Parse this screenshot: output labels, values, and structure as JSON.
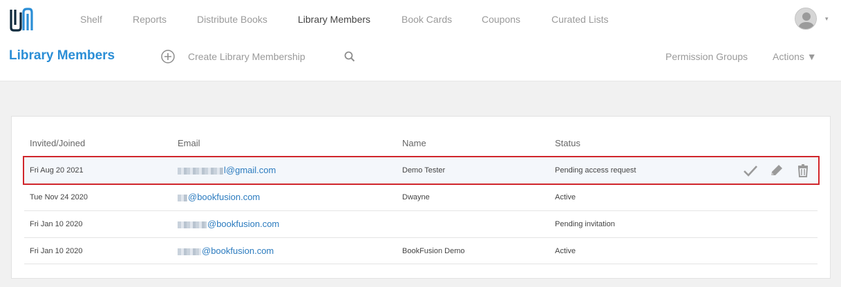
{
  "nav": {
    "items": [
      {
        "label": "Shelf",
        "active": false
      },
      {
        "label": "Reports",
        "active": false
      },
      {
        "label": "Distribute Books",
        "active": false
      },
      {
        "label": "Library Members",
        "active": true
      },
      {
        "label": "Book Cards",
        "active": false
      },
      {
        "label": "Coupons",
        "active": false
      },
      {
        "label": "Curated Lists",
        "active": false
      }
    ],
    "caret": "▾"
  },
  "subheader": {
    "title": "Library Members",
    "create_label": "Create Library Membership",
    "permission_groups": "Permission Groups",
    "actions": "Actions ▼"
  },
  "table": {
    "headers": {
      "invited": "Invited/Joined",
      "email": "Email",
      "name": "Name",
      "status": "Status"
    },
    "rows": [
      {
        "date": "Fri Aug 20 2021",
        "email_domain": "l@gmail.com",
        "name": "Demo Tester",
        "status": "Pending access request"
      },
      {
        "date": "Tue Nov 24 2020",
        "email_domain": "@bookfusion.com",
        "name": "Dwayne",
        "status": "Active"
      },
      {
        "date": "Fri Jan 10 2020",
        "email_domain": "@bookfusion.com",
        "name": "",
        "status": "Pending invitation"
      },
      {
        "date": "Fri Jan 10 2020",
        "email_domain": "@bookfusion.com",
        "name": "BookFusion Demo",
        "status": "Active"
      }
    ]
  },
  "colors": {
    "accent": "#2b8ed6",
    "link": "#2b7bbf",
    "highlight": "#d0262c",
    "muted": "#9a9a9a"
  },
  "icons": [
    "logo-icon",
    "avatar-icon",
    "plus-circle-icon",
    "search-icon",
    "check-icon",
    "pencil-icon",
    "trash-icon"
  ]
}
